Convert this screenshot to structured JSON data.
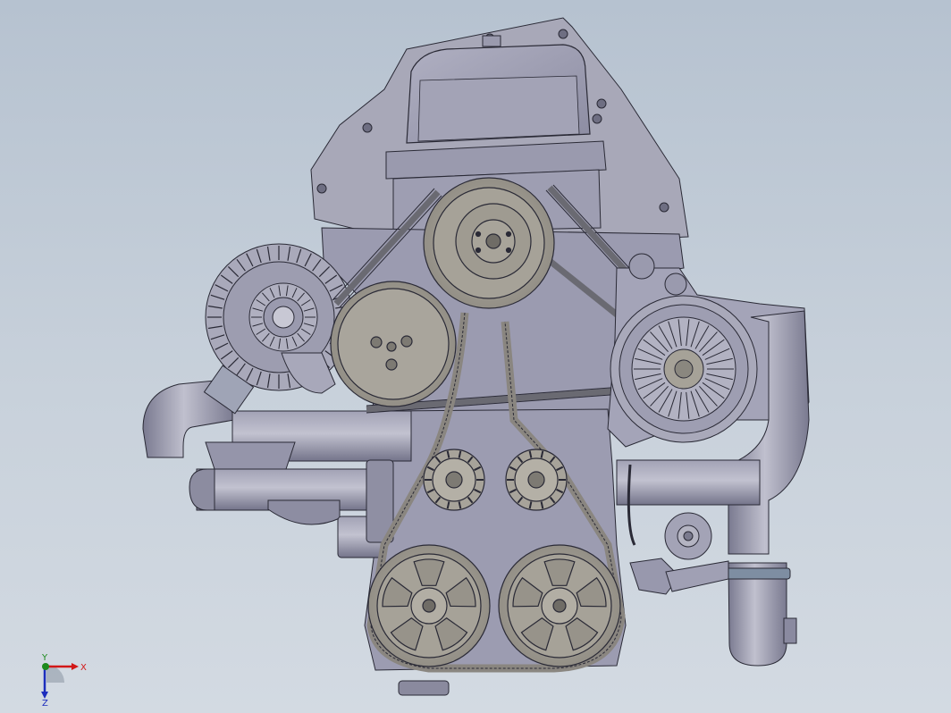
{
  "scene": {
    "background_top": "#b6c2d0",
    "background_bottom": "#d3dae2",
    "metal_color": "#9b9bb0",
    "metal_dark": "#7e7e94",
    "pulley_color": "#a7a39a",
    "outline_color": "#2a2a36"
  },
  "triad": {
    "x_label": "X",
    "y_label": "Y",
    "z_label": "Z",
    "x_color": "#d21818",
    "y_color": "#1d8a1d",
    "z_color": "#1c2dbd"
  }
}
